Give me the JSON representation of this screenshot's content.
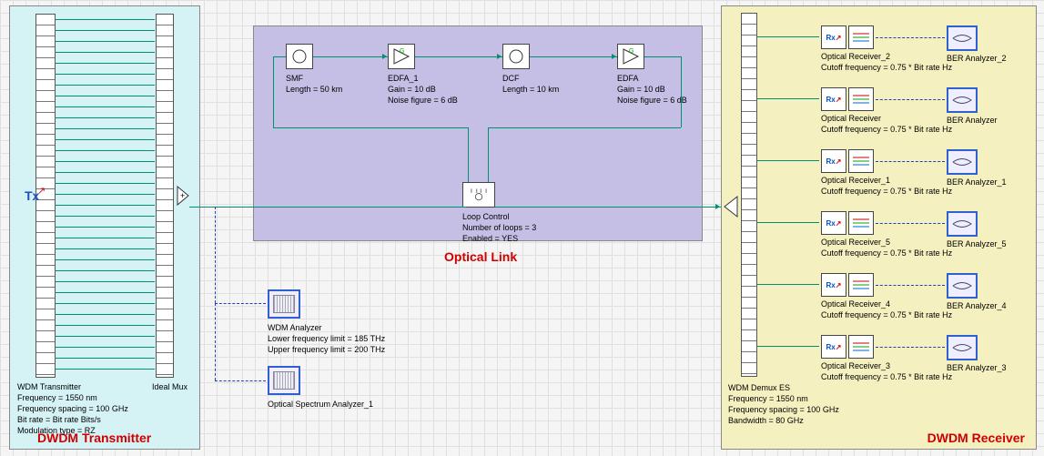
{
  "sections": {
    "transmitter_title": "DWDM Transmitter",
    "link_title": "Optical Link",
    "receiver_title": "DWDM Receiver"
  },
  "transmitter": {
    "icon": "Tx",
    "name": "WDM Transmitter",
    "params": [
      "Frequency = 1550  nm",
      "Frequency spacing = 100  GHz",
      "Bit rate = Bit rate  Bits/s",
      "Modulation type = RZ"
    ],
    "mux_label": "Ideal Mux"
  },
  "link": {
    "smf": {
      "label": "SMF",
      "param": "Length = 50  km"
    },
    "edfa1": {
      "label": "EDFA_1",
      "param1": "Gain = 10  dB",
      "param2": "Noise figure = 6  dB"
    },
    "dcf": {
      "label": "DCF",
      "param": "Length = 10  km"
    },
    "edfa2": {
      "label": "EDFA",
      "param1": "Gain = 10  dB",
      "param2": "Noise figure = 6  dB"
    },
    "loop": {
      "label": "Loop Control",
      "param1": "Number of loops = 3",
      "param2": "Enabled = YES"
    }
  },
  "analyzers": {
    "wdm": {
      "label": "WDM Analyzer",
      "param1": "Lower frequency limit = 185  THz",
      "param2": "Upper frequency limit = 200  THz"
    },
    "osa": {
      "label": "Optical Spectrum Analyzer_1"
    }
  },
  "demux": {
    "name": "WDM Demux ES",
    "params": [
      "Frequency = 1550  nm",
      "Frequency spacing = 100  GHz",
      "Bandwidth = 80  GHz"
    ]
  },
  "receivers": [
    {
      "rx_label": "Optical Receiver_2",
      "rx_param": "Cutoff  frequency = 0.75 * Bit rate  Hz",
      "ber_label": "BER Analyzer_2"
    },
    {
      "rx_label": "Optical Receiver",
      "rx_param": "Cutoff  frequency = 0.75 * Bit rate  Hz",
      "ber_label": "BER Analyzer"
    },
    {
      "rx_label": "Optical Receiver_1",
      "rx_param": "Cutoff  frequency = 0.75 * Bit rate  Hz",
      "ber_label": "BER Analyzer_1"
    },
    {
      "rx_label": "Optical Receiver_5",
      "rx_param": "Cutoff  frequency = 0.75 * Bit rate  Hz",
      "ber_label": "BER Analyzer_5"
    },
    {
      "rx_label": "Optical Receiver_4",
      "rx_param": "Cutoff  frequency = 0.75 * Bit rate  Hz",
      "ber_label": "BER Analyzer_4"
    },
    {
      "rx_label": "Optical Receiver_3",
      "rx_param": "Cutoff  frequency = 0.75 * Bit rate  Hz",
      "ber_label": "BER Analyzer_3"
    }
  ],
  "icons": {
    "rx": "Rx"
  }
}
